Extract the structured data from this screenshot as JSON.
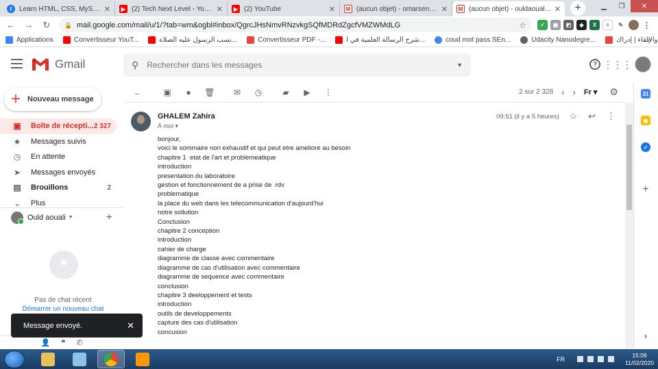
{
  "browser": {
    "tabs": [
      {
        "title": "Learn HTML, CSS, MySQL, PHP ...",
        "icon": "facebook-icon",
        "color": "#1877f2"
      },
      {
        "title": "(2) Tech Next Level - YouTube",
        "icon": "youtube-icon",
        "color": "#ff0000"
      },
      {
        "title": "(2) YouTube",
        "icon": "youtube-icon",
        "color": "#ff0000"
      },
      {
        "title": "(aucun objet) - omarsen6@gma...",
        "icon": "gmail-icon",
        "color": "#d93025"
      },
      {
        "title": "(aucun objet) - ouldaouali.aek@...",
        "icon": "gmail-icon",
        "color": "#d93025"
      }
    ],
    "url": "mail.google.com/mail/u/1/?tab=wm&ogbl#inbox/QgrcJHsNmvRNzvkgSQfMDRdZgcfVMZWMdLG",
    "bookmarks": [
      {
        "label": "Applications",
        "color": "#4285f4"
      },
      {
        "label": "Convertisseur YouT...",
        "color": "#ff0000"
      },
      {
        "label": "نسب الرسول عليه الصلاة...",
        "color": "#ff0000"
      },
      {
        "label": "Convertisseur PDF -...",
        "color": "#e8453c"
      },
      {
        "label": "شرح الرسالة العلمية في ا...",
        "color": "#ff0000"
      },
      {
        "label": "coud mot pass SEn...",
        "color": "#4285f4"
      },
      {
        "label": "Udacity Nanodegre...",
        "color": "#5f6368"
      },
      {
        "label": "فن الخطابة والإلقاء | إدراك",
        "color": "#e8453c"
      }
    ]
  },
  "gmail": {
    "app_name": "Gmail",
    "search_placeholder": "Rechercher dans les messages",
    "compose_label": "Nouveau message",
    "nav": [
      {
        "label": "Boîte de récepti...",
        "count": "2 327",
        "icon": "inbox-icon"
      },
      {
        "label": "Messages suivis",
        "count": "",
        "icon": "star-icon"
      },
      {
        "label": "En attente",
        "count": "",
        "icon": "clock-icon"
      },
      {
        "label": "Messages envoyés",
        "count": "",
        "icon": "send-icon"
      },
      {
        "label": "Brouillons",
        "count": "2",
        "icon": "draft-icon"
      },
      {
        "label": "Plus",
        "count": "",
        "icon": "chevron-down-icon"
      }
    ],
    "hangouts_user": "Ould aouali",
    "no_chat": "Pas de chat récent",
    "new_chat": "Démarrer un nouveau chat",
    "toast": "Message envoyé.",
    "pager": "2 sur 2 328",
    "lang": "Fr"
  },
  "message": {
    "sender": "GHALEM Zahira",
    "to": "À moi",
    "time": "09:51 (il y a 5 heures)",
    "lines": [
      "bonjour,",
      "voici le sommaire non exhaustif et qui peut etre ameliore au besoin",
      "chapitre 1  etat de l'art et problemeatique",
      "introduction",
      "presentation du laboratoire",
      "gestion et fonctionnement de a prise de  rdv",
      "problematique",
      "la place du web dans les telecommunication d'aujourd'hui",
      "notre sollution",
      "Conclusion",
      "chapitre 2 conception",
      "introduction",
      "cahier de charge",
      "diagramme de classe avec commentaire",
      "diagramme de cas d'utilisation avec commentaire",
      "diagramme de sequence avec commentaire",
      "conclusion",
      "chapitre 3 deeloppement et tests",
      "introduction",
      "outils de developpements",
      "capture des cas d'utilisation",
      "concusion"
    ]
  },
  "taskbar": {
    "lang": "FR",
    "time": "15:09",
    "date": "11/02/2020"
  }
}
